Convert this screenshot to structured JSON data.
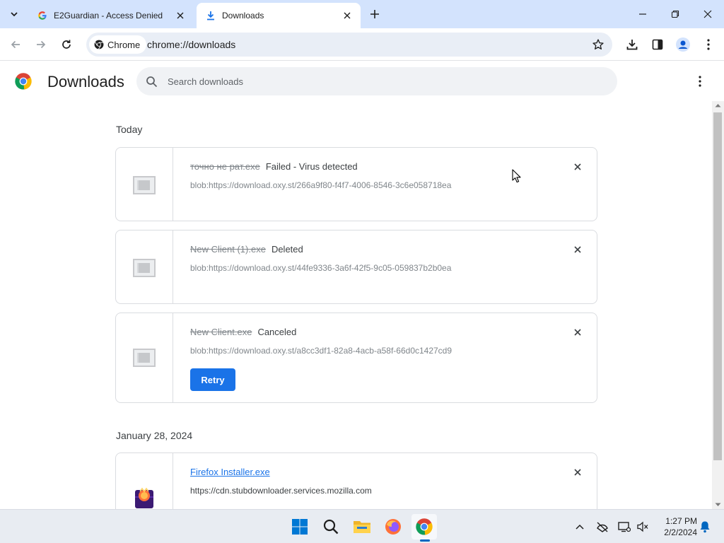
{
  "tabs": [
    {
      "title": "E2Guardian - Access Denied",
      "favicon": "google-g-icon",
      "active": false
    },
    {
      "title": "Downloads",
      "favicon": "download-icon",
      "active": true
    }
  ],
  "toolbar": {
    "chip_label": "Chrome",
    "url": "chrome://downloads"
  },
  "page": {
    "title": "Downloads",
    "search_placeholder": "Search downloads"
  },
  "groups": [
    {
      "date": "Today",
      "items": [
        {
          "filename": "точно не рат.exe",
          "status": "Failed - Virus detected",
          "url": "blob:https://download.oxy.st/266a9f80-f4f7-4006-8546-3c6e058718ea"
        },
        {
          "filename": "New Client (1).exe",
          "status": "Deleted",
          "url": "blob:https://download.oxy.st/44fe9336-3a6f-42f5-9c05-059837b2b0ea"
        },
        {
          "filename": "New Client.exe",
          "status": "Canceled",
          "url": "blob:https://download.oxy.st/a8cc3df1-82a8-4acb-a58f-66d0c1427cd9",
          "action": "Retry"
        }
      ]
    },
    {
      "date": "January 28, 2024",
      "items": [
        {
          "filename": "Firefox Installer.exe",
          "status": "",
          "url": "https://cdn.stubdownloader.services.mozilla.com"
        }
      ]
    }
  ],
  "taskbar": {
    "apps": [
      "windows-start-icon",
      "search-icon",
      "file-explorer-icon",
      "firefox-icon",
      "chrome-icon"
    ],
    "time": "1:27 PM",
    "date": "2/2/2024"
  },
  "colors": {
    "accent": "#1a73e8",
    "tabstrip": "#d3e3fd",
    "omnibox": "#e9eef6"
  }
}
